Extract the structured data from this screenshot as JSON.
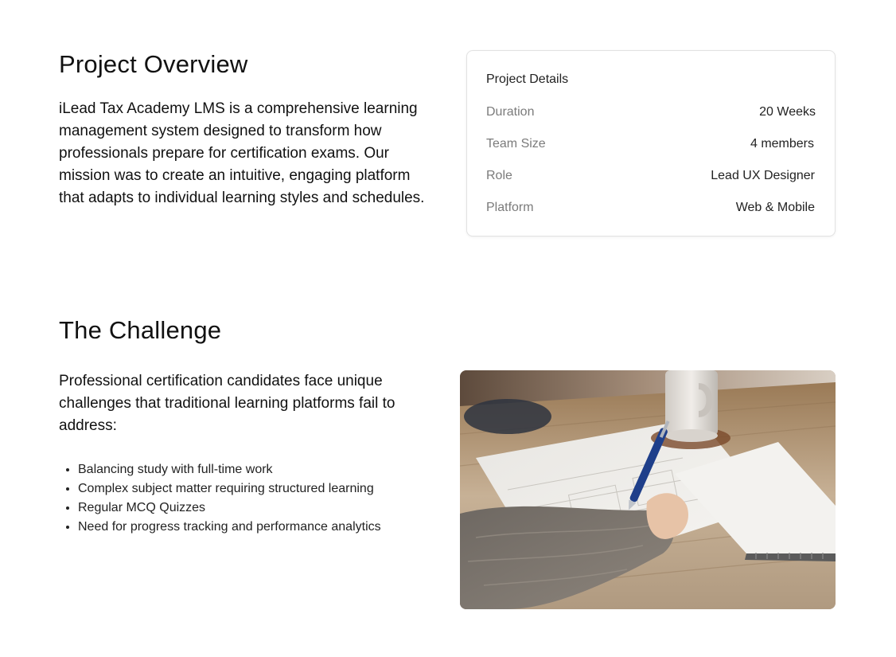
{
  "overview": {
    "title": "Project Overview",
    "description": "iLead Tax Academy LMS is a comprehensive learning management system designed to transform how professionals prepare for certification exams. Our mission was to create an intuitive, engaging platform that adapts to individual learning styles and schedules."
  },
  "details": {
    "title": "Project Details",
    "rows": [
      {
        "label": "Duration",
        "value": "20 Weeks"
      },
      {
        "label": "Team Size",
        "value": "4 members"
      },
      {
        "label": "Role",
        "value": "Lead UX Designer"
      },
      {
        "label": "Platform",
        "value": "Web & Mobile"
      }
    ]
  },
  "challenge": {
    "title": "The Challenge",
    "description": "Professional certification candidates face unique challenges that traditional learning platforms fail to address:",
    "points": [
      "Balancing study with full-time work",
      "Complex subject matter requiring structured learning",
      "Regular MCQ Quizzes",
      "Need for progress tracking and performance analytics"
    ],
    "image": {
      "subject": "hand-writing-with-pen-on-notebook-photo"
    }
  },
  "colors": {
    "text_primary": "#111111",
    "text_muted": "#7b7b7b",
    "card_border": "#e2e2e2",
    "background": "#ffffff"
  }
}
